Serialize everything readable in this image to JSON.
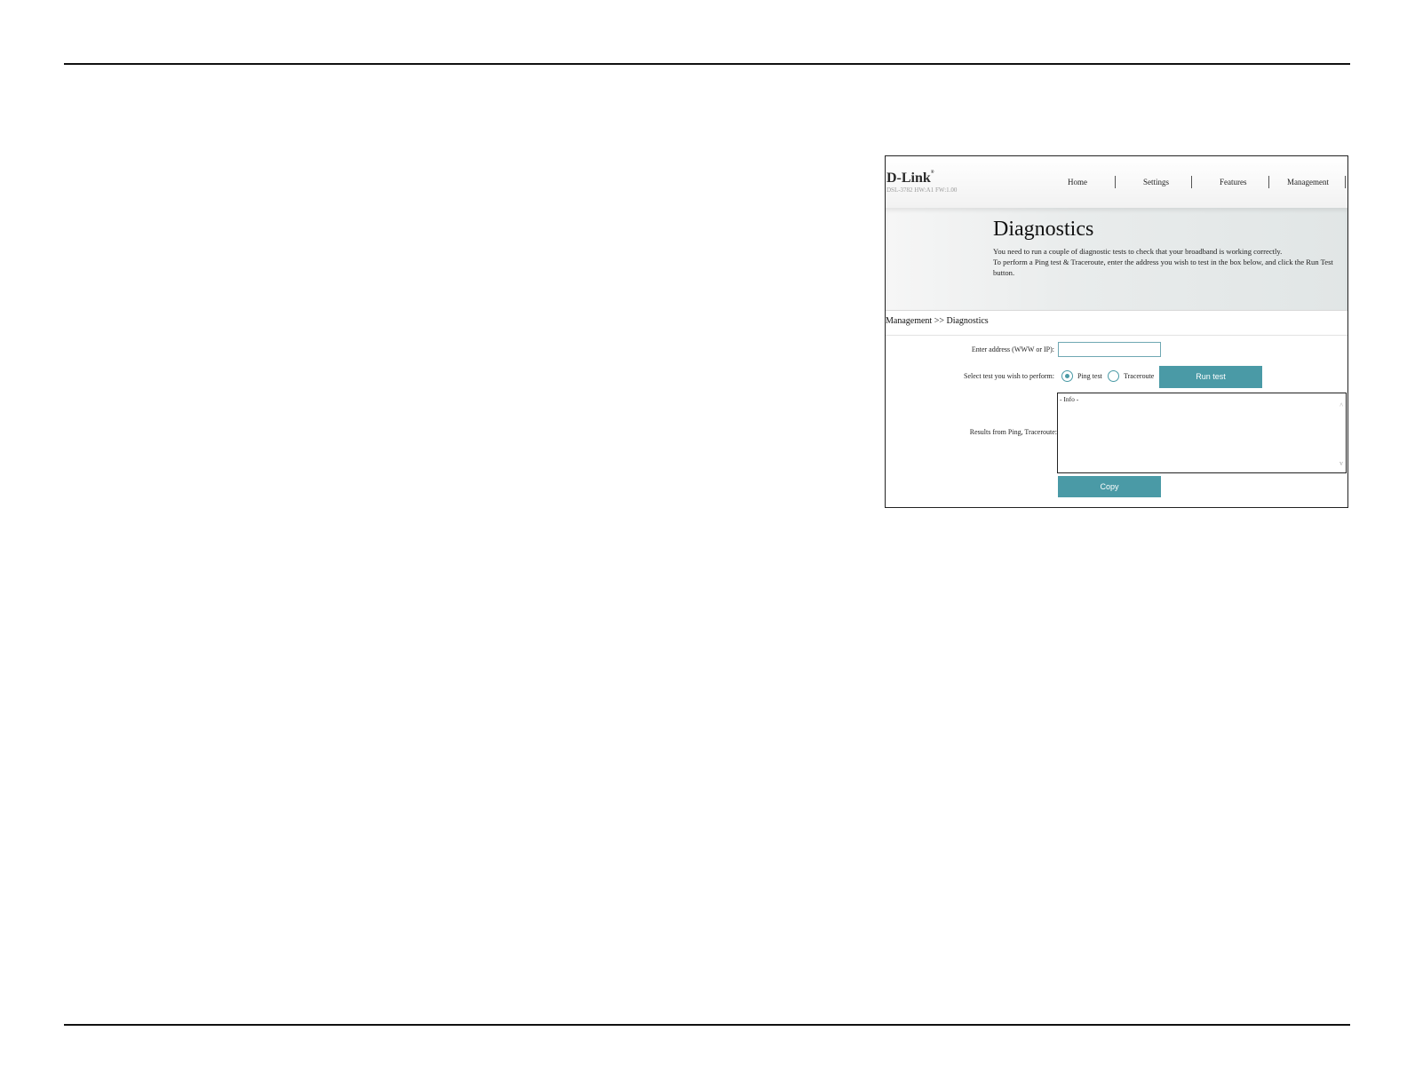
{
  "router": {
    "logo": "D-Link",
    "model_info": "DSL-3782 HW:A1 FW:1.00",
    "nav": [
      "Home",
      "Settings",
      "Features",
      "Management"
    ]
  },
  "banner": {
    "title": "Diagnostics",
    "line1": "You need to run a couple of diagnostic tests to check that your broadband is working correctly.",
    "line2": "To perform a Ping test & Traceroute, enter the address you wish to test in the box below, and click the Run Test button."
  },
  "breadcrumb": "Management >> Diagnostics",
  "form": {
    "address_label": "Enter address (WWW or IP):",
    "address_value": "",
    "test_label": "Select test you wish to perform:",
    "ping_label": "Ping test",
    "traceroute_label": "Traceroute",
    "selected_test": "Ping test",
    "run_button": "Run test",
    "results_label": "Results from Ping, Traceroute:",
    "results_text": "- Info -",
    "copy_button": "Copy"
  },
  "colors": {
    "accent": "#4a9aa6"
  }
}
